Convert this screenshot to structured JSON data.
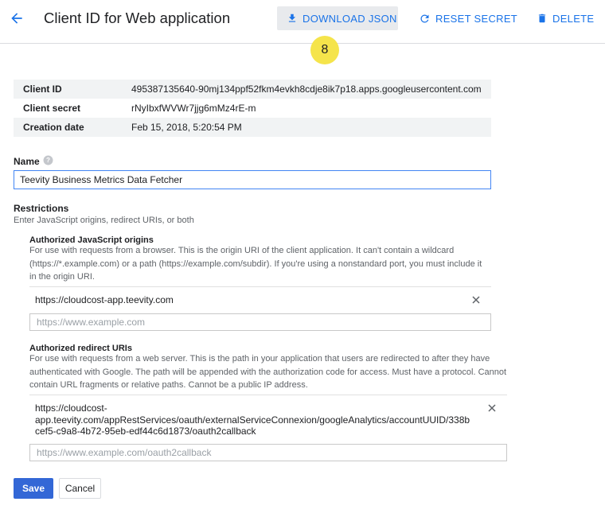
{
  "header": {
    "title": "Client ID for Web application",
    "download_label": "DOWNLOAD JSON",
    "reset_label": "RESET SECRET",
    "delete_label": "DELETE"
  },
  "step_badge": "8",
  "client_info": [
    {
      "key": "Client ID",
      "value": "495387135640-90mj134ppf52fkm4evkh8cdje8ik7p18.apps.googleusercontent.com"
    },
    {
      "key": "Client secret",
      "value": "rNyIbxfWVWr7jjg6mMz4rE-m"
    },
    {
      "key": "Creation date",
      "value": "Feb 15, 2018, 5:20:54 PM"
    }
  ],
  "name_field": {
    "label": "Name",
    "value": "Teevity Business Metrics Data Fetcher"
  },
  "restrictions": {
    "title": "Restrictions",
    "subtitle": "Enter JavaScript origins, redirect URIs, or both",
    "js_origins": {
      "title": "Authorized JavaScript origins",
      "desc_lines": [
        "For use with requests from a browser. This is the origin URI of the client application. It can't contain a wildcard",
        "(https://*.example.com) or a path (https://example.com/subdir). If you're using a nonstandard port, you must include it",
        "in the origin URI."
      ],
      "entries": [
        "https://cloudcost-app.teevity.com"
      ],
      "placeholder": "https://www.example.com"
    },
    "redirect_uris": {
      "title": "Authorized redirect URIs",
      "desc_lines": [
        "For use with requests from a web server. This is the path in your application that users are redirected to after they have",
        "authenticated with Google. The path will be appended with the authorization code for access. Must have a protocol. Cannot",
        "contain URL fragments or relative paths. Cannot be a public IP address."
      ],
      "entry_lines": [
        "https://cloudcost-",
        "app.teevity.com/appRestServices/oauth/externalServiceConnexion/googleAnalytics/accountUUID/338b",
        "cef5-c9a8-4b72-95eb-edf44c6d1873/oauth2callback"
      ],
      "placeholder": "https://www.example.com/oauth2callback"
    }
  },
  "actions": {
    "save_label": "Save",
    "cancel_label": "Cancel"
  },
  "colors": {
    "accent": "#1a73e8",
    "save_button": "#3367d6",
    "badge": "#f5e44b"
  }
}
